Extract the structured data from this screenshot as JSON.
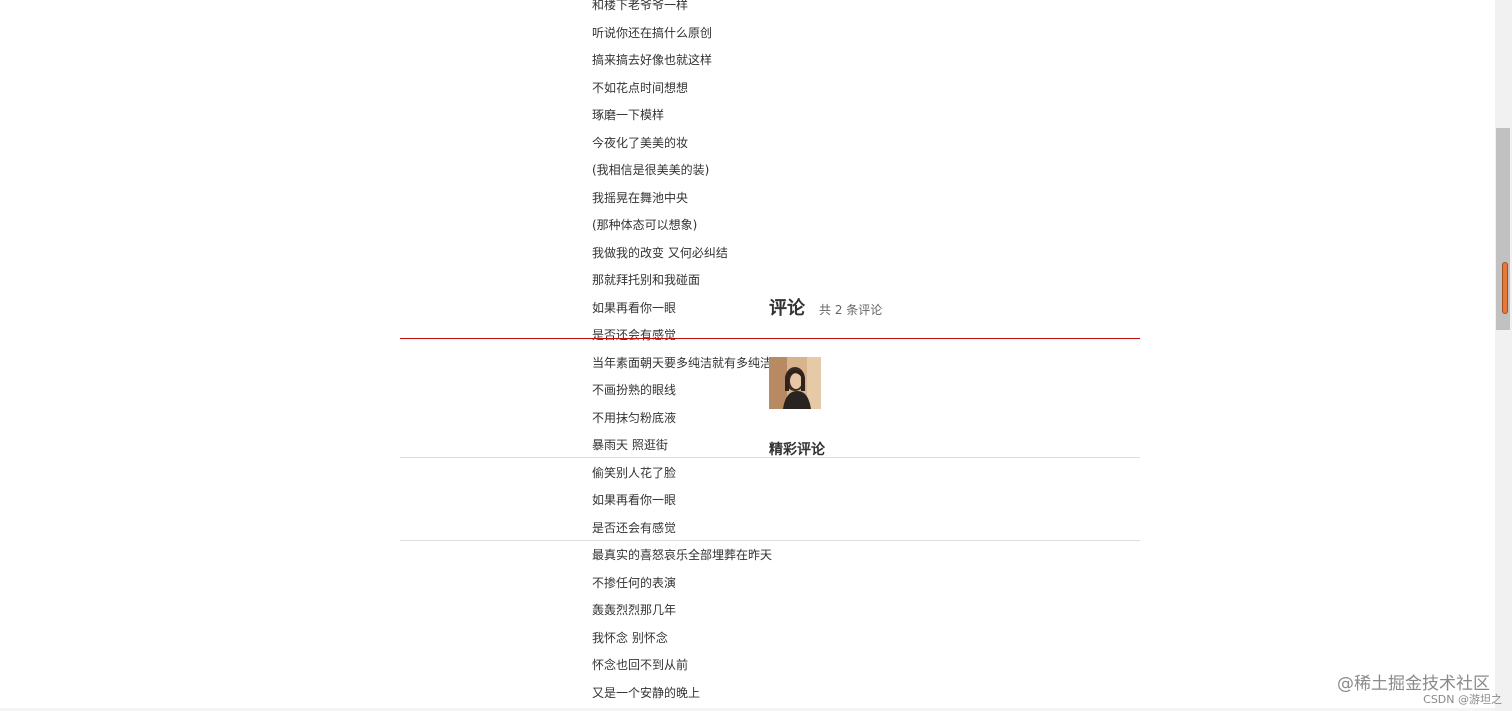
{
  "lyrics": [
    "和楼下老爷爷一样",
    "听说你还在搞什么原创",
    "搞来搞去好像也就这样",
    "不如花点时间想想",
    "琢磨一下模样",
    "今夜化了美美的妆",
    "(我相信是很美美的装)",
    "我摇晃在舞池中央",
    "(那种体态可以想象)",
    "我做我的改变 又何必纠结",
    "那就拜托别和我碰面",
    "如果再看你一眼",
    "是否还会有感觉",
    "当年素面朝天要多纯洁就有多纯洁",
    "不画扮熟的眼线",
    "不用抹匀粉底液",
    "暴雨天 照逛街",
    "偷笑别人花了脸",
    "如果再看你一眼",
    "是否还会有感觉",
    "最真实的喜怒哀乐全部埋葬在昨天",
    "不掺任何的表演",
    "轰轰烈烈那几年",
    "我怀念 别怀念",
    "怀念也回不到从前",
    "又是一个安静的晚上"
  ],
  "comments": {
    "title": "评论",
    "count_text": "共 2 条评论",
    "hot_title": "精彩评论"
  },
  "watermark": {
    "main": "@稀土掘金技术社区",
    "sub": "CSDN @游坦之"
  },
  "colors": {
    "accent_line": "#c20c0c",
    "scroll_marker": "#e8773a"
  }
}
